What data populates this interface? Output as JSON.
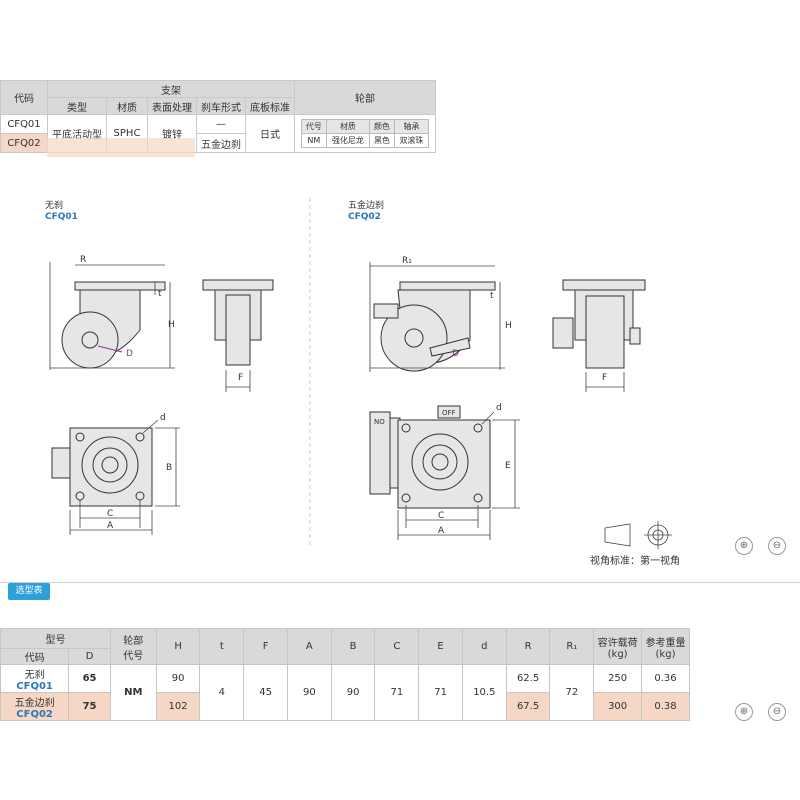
{
  "spec_table": {
    "h_code": "代码",
    "h_bracket": "支架",
    "h_wheel": "轮部",
    "h_type": "类型",
    "h_material": "材质",
    "h_surface": "表面处理",
    "h_brake": "刹车形式",
    "h_base": "底板标准",
    "code1": "CFQ01",
    "code2": "CFQ02",
    "type": "平底活动型",
    "material": "SPHC",
    "surface": "镀锌",
    "brake1": "—",
    "brake2": "五金边刹",
    "base": "日式",
    "wheel_sub": {
      "h_code": "代号",
      "h_material": "材质",
      "h_color": "颜色",
      "h_bearing": "轴承",
      "code": "NM",
      "material": "强化尼龙",
      "color": "黑色",
      "bearing": "双滚珠"
    }
  },
  "drawing": {
    "left_title": "无刹",
    "left_code": "CFQ01",
    "right_title": "五金边刹",
    "right_code": "CFQ02",
    "labels": {
      "R": "R",
      "R1": "R₁",
      "t": "t",
      "H": "H",
      "D": "D",
      "F": "F",
      "d": "d",
      "B": "B",
      "C": "C",
      "A": "A",
      "E": "E",
      "no": "NO",
      "off": "OFF"
    },
    "view_note": "视角标准：第一视角"
  },
  "zoom_icons": [
    "⊕",
    "⊖"
  ],
  "selection_tab": "选型表",
  "selection_table": {
    "h_model": "型号",
    "h_code": "代码",
    "h_D": "D",
    "h_wheel_code": "轮部\n代号",
    "cols": [
      "H",
      "t",
      "F",
      "A",
      "B",
      "C",
      "E",
      "d",
      "R",
      "R₁"
    ],
    "h_load": "容许载荷\n(kg)",
    "h_weight": "参考重量\n(kg)",
    "row1_name": "无刹",
    "row1_code": "CFQ01",
    "row1_D": "65",
    "row1_H": "90",
    "row1_R": "62.5",
    "row1_load": "250",
    "row1_weight": "0.36",
    "row2_name": "五金边刹",
    "row2_code": "CFQ02",
    "row2_D": "75",
    "row2_H": "102",
    "row2_R": "67.5",
    "row2_load": "300",
    "row2_weight": "0.38",
    "wheel_code": "NM",
    "t": "4",
    "F": "45",
    "A": "90",
    "B": "90",
    "C": "71",
    "E": "71",
    "d": "10.5",
    "R1": "72"
  }
}
